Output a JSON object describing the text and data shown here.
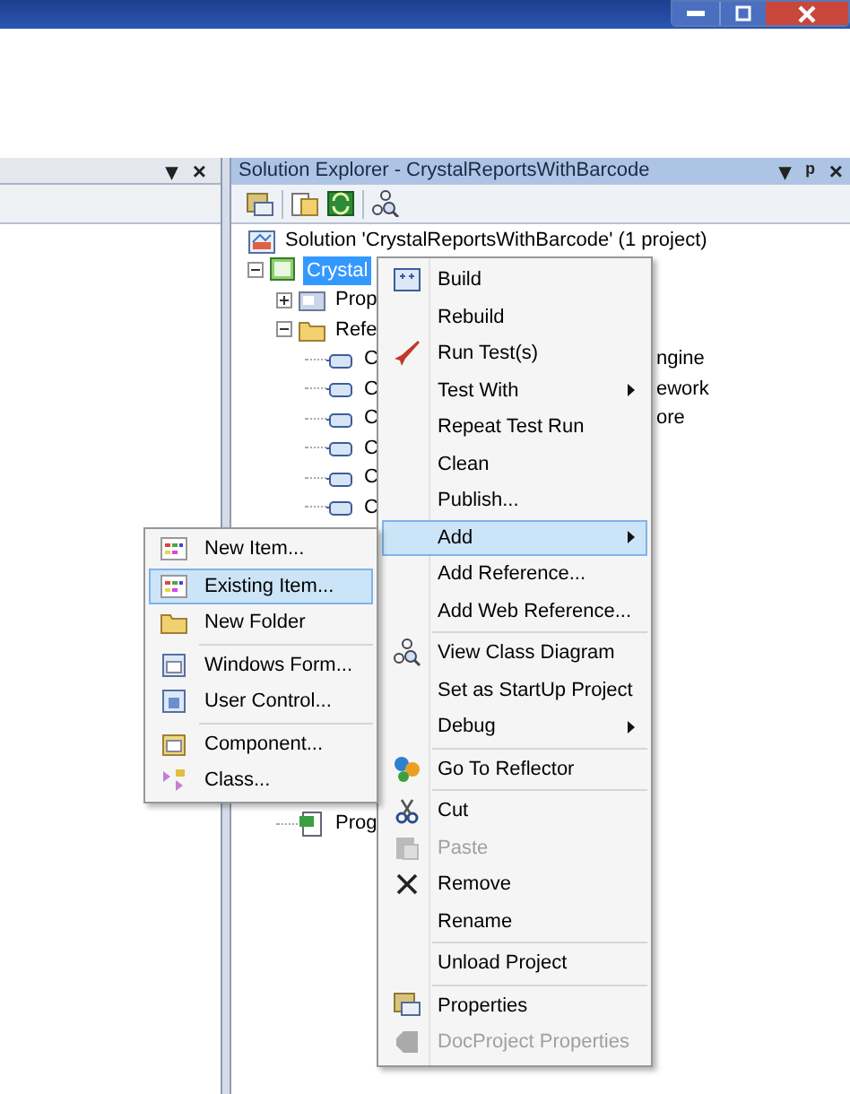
{
  "left_panel": {
    "header_buttons": [
      "▾",
      "×"
    ]
  },
  "solution_explorer": {
    "title": "Solution Explorer - CrystalReportsWithBarcode",
    "header_buttons": [
      "▾",
      "ᵖ",
      "×"
    ],
    "tree": [
      {
        "label": "Solution 'CrystalReportsWithBarcode' (1 project)",
        "selected": false,
        "children": [
          {
            "label": "Crystal",
            "expanded": true,
            "selected": true,
            "children": [
              {
                "label": "Prop",
                "expanded": false,
                "selected": false
              },
              {
                "label": "Refe",
                "expanded": true,
                "selected": false,
                "children": [
                  {
                    "label": "C",
                    "tail": "ngine",
                    "selected": false
                  },
                  {
                    "label": "C",
                    "tail": "ework",
                    "selected": false
                  },
                  {
                    "label": "C",
                    "tail": "ore",
                    "selected": false
                  },
                  {
                    "label": "C",
                    "selected": false
                  },
                  {
                    "label": "C",
                    "selected": false
                  },
                  {
                    "label": "C",
                    "selected": false
                  }
                ]
              },
              {
                "label": "Prog",
                "selected": false
              }
            ]
          }
        ]
      }
    ]
  },
  "context_menu": [
    {
      "label": "Build",
      "selected": false,
      "disabled": false,
      "submenu": false,
      "separator_before": false
    },
    {
      "label": "Rebuild",
      "selected": false,
      "disabled": false,
      "submenu": false,
      "separator_before": false
    },
    {
      "label": "Run Test(s)",
      "selected": false,
      "disabled": false,
      "submenu": false,
      "separator_before": false
    },
    {
      "label": "Test With",
      "selected": false,
      "disabled": false,
      "submenu": true,
      "separator_before": false
    },
    {
      "label": "Repeat Test Run",
      "selected": false,
      "disabled": false,
      "submenu": false,
      "separator_before": false
    },
    {
      "label": "Clean",
      "selected": false,
      "disabled": false,
      "submenu": false,
      "separator_before": false
    },
    {
      "label": "Publish...",
      "selected": false,
      "disabled": false,
      "submenu": false,
      "separator_before": false
    },
    {
      "label": "Add",
      "selected": true,
      "disabled": false,
      "submenu": true,
      "separator_before": false
    },
    {
      "label": "Add Reference...",
      "selected": false,
      "disabled": false,
      "submenu": false,
      "separator_before": false
    },
    {
      "label": "Add Web Reference...",
      "selected": false,
      "disabled": false,
      "submenu": false,
      "separator_before": false
    },
    {
      "label": "View Class Diagram",
      "selected": false,
      "disabled": false,
      "submenu": false,
      "separator_before": true
    },
    {
      "label": "Set as StartUp Project",
      "selected": false,
      "disabled": false,
      "submenu": false,
      "separator_before": false
    },
    {
      "label": "Debug",
      "selected": false,
      "disabled": false,
      "submenu": true,
      "separator_before": false
    },
    {
      "label": "Go To Reflector",
      "selected": false,
      "disabled": false,
      "submenu": false,
      "separator_before": true
    },
    {
      "label": "Cut",
      "selected": false,
      "disabled": false,
      "submenu": false,
      "separator_before": true
    },
    {
      "label": "Paste",
      "selected": false,
      "disabled": true,
      "submenu": false,
      "separator_before": false
    },
    {
      "label": "Remove",
      "selected": false,
      "disabled": false,
      "submenu": false,
      "separator_before": false
    },
    {
      "label": "Rename",
      "selected": false,
      "disabled": false,
      "submenu": false,
      "separator_before": false
    },
    {
      "label": "Unload Project",
      "selected": false,
      "disabled": false,
      "submenu": false,
      "separator_before": true
    },
    {
      "label": "Properties",
      "selected": false,
      "disabled": false,
      "submenu": false,
      "separator_before": true
    },
    {
      "label": "DocProject Properties",
      "selected": false,
      "disabled": true,
      "submenu": false,
      "separator_before": false
    }
  ],
  "add_submenu": [
    {
      "label": "New Item...",
      "selected": false,
      "separator_before": false
    },
    {
      "label": "Existing Item...",
      "selected": true,
      "separator_before": false
    },
    {
      "label": "New Folder",
      "selected": false,
      "separator_before": false
    },
    {
      "label": "Windows Form...",
      "selected": false,
      "separator_before": true
    },
    {
      "label": "User Control...",
      "selected": false,
      "separator_before": false
    },
    {
      "label": "Component...",
      "selected": false,
      "separator_before": true
    },
    {
      "label": "Class...",
      "selected": false,
      "separator_before": false
    }
  ]
}
